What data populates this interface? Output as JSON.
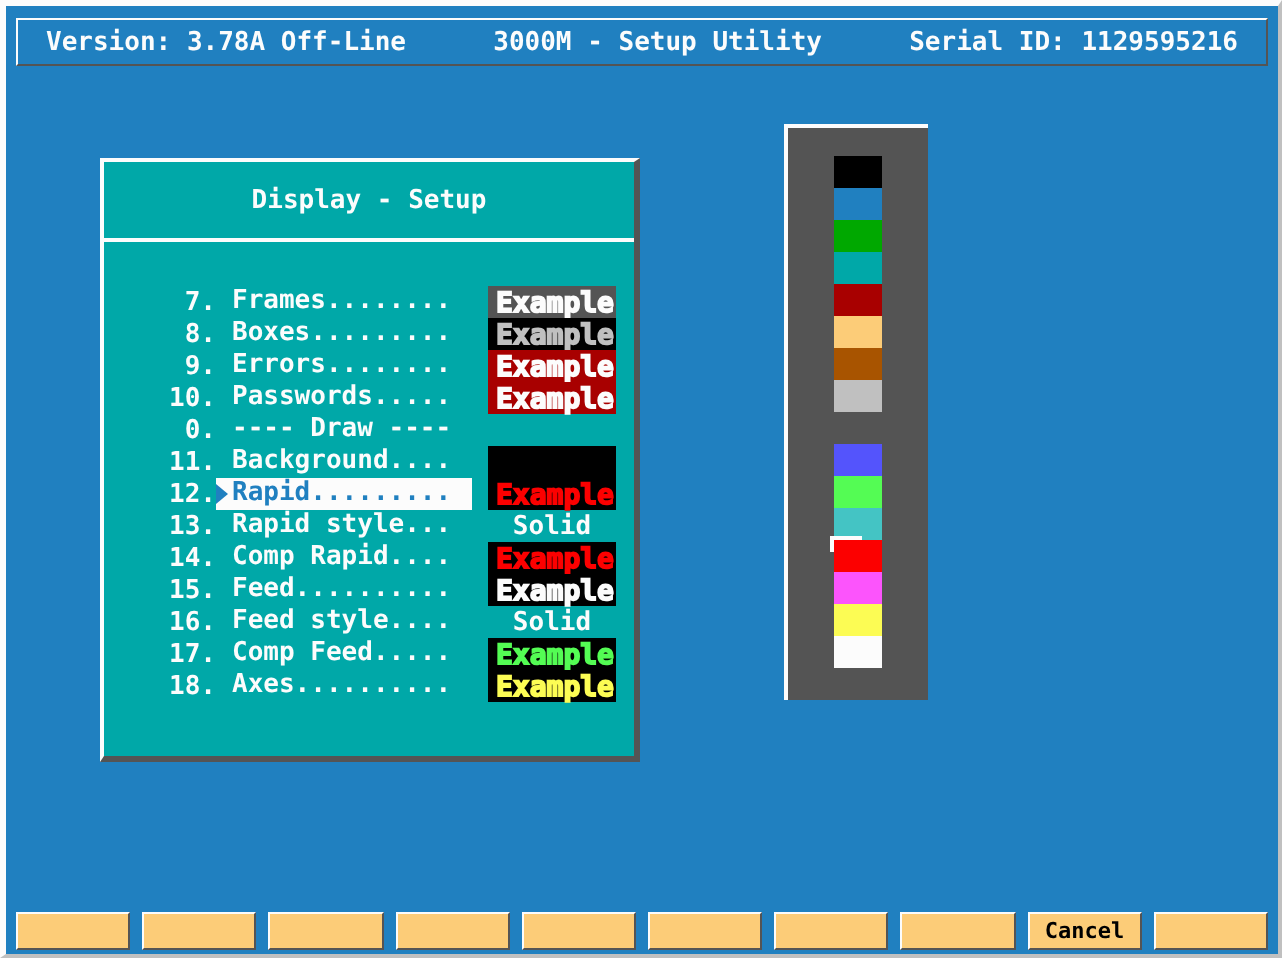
{
  "header": {
    "version": "Version: 3.78A Off-Line",
    "title": "3000M - Setup Utility",
    "serial": "Serial ID: 1129595216"
  },
  "dialog": {
    "title": "Display - Setup",
    "rows": [
      {
        "number": "7.",
        "label": "Frames........",
        "selected": false,
        "sample": {
          "kind": "example",
          "text": "Example",
          "color": "#fcfcfc",
          "background": {
            "color": "#545454"
          }
        }
      },
      {
        "number": "8.",
        "label": "Boxes.........",
        "selected": false,
        "sample": {
          "kind": "example",
          "text": "Example",
          "color": "#c0c0c0",
          "background": {
            "color": "#000000"
          }
        }
      },
      {
        "number": "9.",
        "label": "Errors........",
        "selected": false,
        "sample": {
          "kind": "example",
          "text": "Example",
          "color": "#fcfcfc",
          "background": {
            "color": "#a80000"
          }
        }
      },
      {
        "number": "10.",
        "label": "Passwords.....",
        "selected": false,
        "sample": {
          "kind": "example",
          "text": "Example",
          "color": "#fcfcfc",
          "background": {
            "color": "#a80000"
          }
        }
      },
      {
        "number": "0.",
        "label": "---- Draw ----",
        "selected": false,
        "sample": {
          "kind": "none"
        }
      },
      {
        "number": "11.",
        "label": "Background....",
        "selected": false,
        "sample": {
          "kind": "fill",
          "background": {
            "color": "#000000"
          }
        }
      },
      {
        "number": "12.",
        "label": "Rapid.........",
        "selected": true,
        "sample": {
          "kind": "example",
          "text": "Example",
          "color": "#fc0000",
          "background": {
            "color": "#000000"
          }
        }
      },
      {
        "number": "13.",
        "label": "Rapid style...",
        "selected": false,
        "sample": {
          "kind": "style",
          "text": "Solid"
        }
      },
      {
        "number": "14.",
        "label": "Comp Rapid....",
        "selected": false,
        "sample": {
          "kind": "example",
          "text": "Example",
          "color": "#fc0000",
          "background": {
            "color": "#000000"
          }
        }
      },
      {
        "number": "15.",
        "label": "Feed..........",
        "selected": false,
        "sample": {
          "kind": "example",
          "text": "Example",
          "color": "#fcfcfc",
          "background": {
            "color": "#000000"
          }
        }
      },
      {
        "number": "16.",
        "label": "Feed style....",
        "selected": false,
        "sample": {
          "kind": "style",
          "text": "Solid"
        }
      },
      {
        "number": "17.",
        "label": "Comp Feed.....",
        "selected": false,
        "sample": {
          "kind": "example",
          "text": "Example",
          "color": "#54fc54",
          "background": {
            "color": "#000000"
          }
        }
      },
      {
        "number": "18.",
        "label": "Axes..........",
        "selected": false,
        "sample": {
          "kind": "example",
          "text": "Example",
          "color": "#fcfc54",
          "background": {
            "color": "#000000"
          }
        }
      }
    ]
  },
  "palette": {
    "groups": [
      [
        {
          "color": "#000000",
          "selected": false
        },
        {
          "color": "#2080c0",
          "selected": false
        },
        {
          "color": "#00a800",
          "selected": false
        },
        {
          "color": "#00a8a8",
          "selected": false
        },
        {
          "color": "#a80000",
          "selected": false
        },
        {
          "color": "#fccc78",
          "selected": false
        },
        {
          "color": "#a85400",
          "selected": false
        },
        {
          "color": "#c0c0c0",
          "selected": false
        }
      ],
      [
        {
          "color": "#5454fc",
          "selected": false
        },
        {
          "color": "#54fc54",
          "selected": false
        },
        {
          "color": "#44c4c4",
          "selected": false
        },
        {
          "color": "#fc0000",
          "selected": true
        },
        {
          "color": "#fc54fc",
          "selected": false
        },
        {
          "color": "#fcfc54",
          "selected": false
        },
        {
          "color": "#fcfcfc",
          "selected": false
        }
      ]
    ]
  },
  "buttons": [
    {
      "kind": "blank"
    },
    {
      "kind": "blank"
    },
    {
      "kind": "blank"
    },
    {
      "kind": "blank"
    },
    {
      "kind": "blank"
    },
    {
      "kind": "blank"
    },
    {
      "kind": "blank"
    },
    {
      "kind": "blank"
    },
    {
      "kind": "labeled",
      "label": "Cancel"
    },
    {
      "kind": "blank"
    }
  ]
}
